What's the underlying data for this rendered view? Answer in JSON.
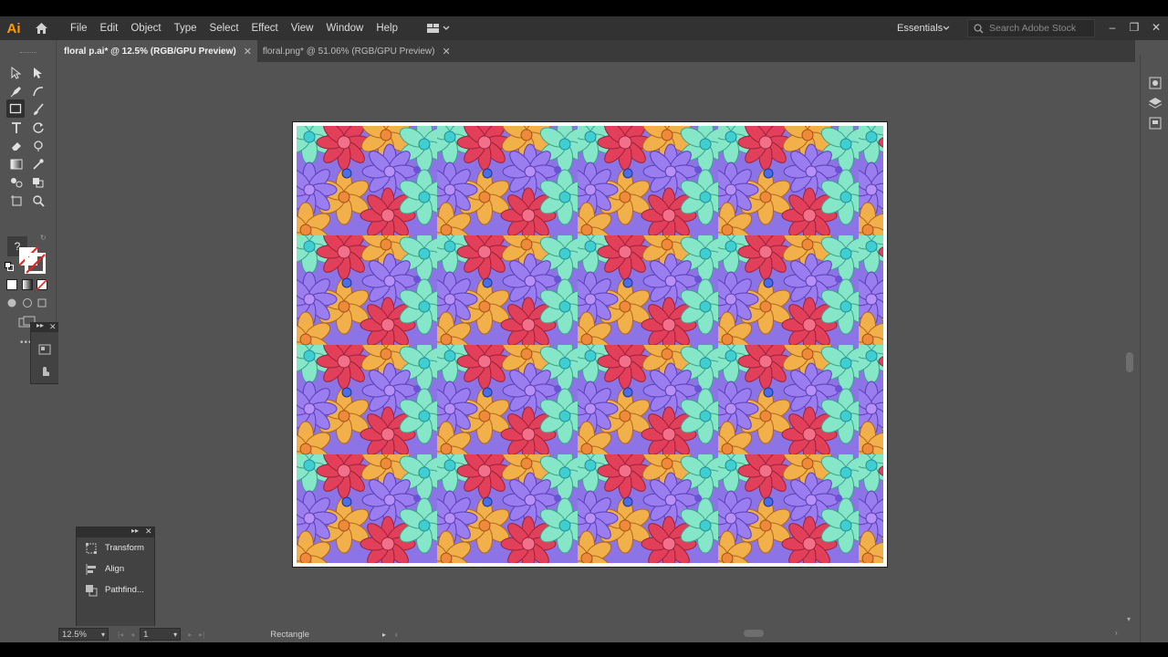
{
  "app": {
    "logo": "Ai"
  },
  "menu": [
    "File",
    "Edit",
    "Object",
    "Type",
    "Select",
    "Effect",
    "View",
    "Window",
    "Help"
  ],
  "workspace": {
    "label": "Essentials"
  },
  "search": {
    "placeholder": "Search Adobe Stock"
  },
  "tabs": [
    {
      "label": "floral p.ai* @ 12.5% (RGB/GPU Preview)",
      "active": true
    },
    {
      "label": "floral.png* @ 51.06% (RGB/GPU Preview)",
      "active": false
    }
  ],
  "colors": {
    "accent": "#ff9a00",
    "ui_dark": "#323232",
    "ui_mid": "#535353"
  },
  "toolbar": {
    "unknown_tool": "?"
  },
  "panels": {
    "properties": [
      {
        "label": "Transform",
        "icon": "transform-icon"
      },
      {
        "label": "Align",
        "icon": "align-icon"
      },
      {
        "label": "Pathfind...",
        "icon": "pathfinder-icon"
      }
    ]
  },
  "status": {
    "zoom": "12.5%",
    "page": "1",
    "selection": "Rectangle"
  }
}
